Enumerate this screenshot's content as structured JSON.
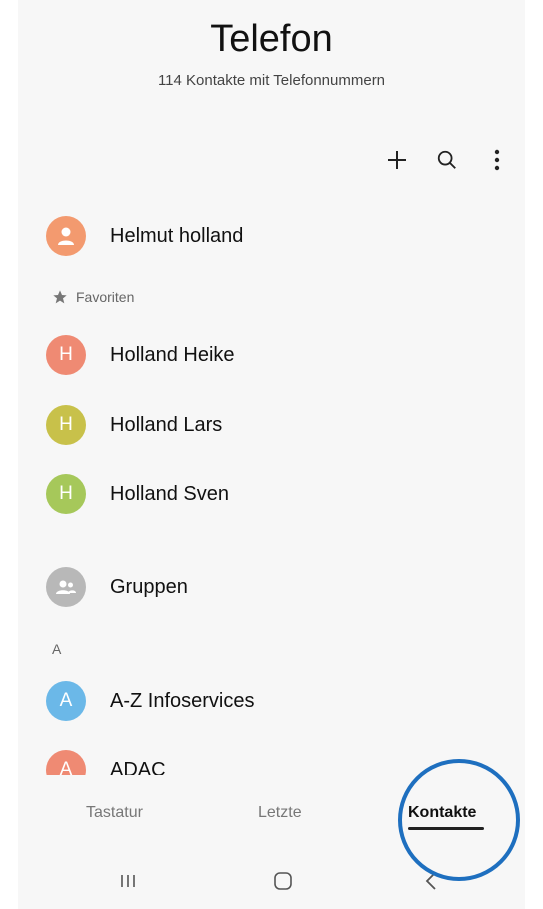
{
  "header": {
    "title": "Telefon",
    "subtitle": "114 Kontakte mit Telefonnummern"
  },
  "toolbar": {
    "add_icon": "plus-icon",
    "search_icon": "search-icon",
    "more_icon": "more-vertical-icon"
  },
  "profile": {
    "name": "Helmut holland",
    "avatar_color": "#f39a6f"
  },
  "favorites": {
    "label": "Favoriten",
    "items": [
      {
        "initial": "H",
        "name": "Holland Heike",
        "color": "#ef8a73"
      },
      {
        "initial": "H",
        "name": "Holland Lars",
        "color": "#c8c14a"
      },
      {
        "initial": "H",
        "name": "Holland Sven",
        "color": "#a6c85a"
      }
    ]
  },
  "groups": {
    "label": "Gruppen",
    "color": "#b8b8b8"
  },
  "index_section": {
    "letter": "A"
  },
  "contacts": [
    {
      "initial": "A",
      "name": "A-Z Infoservices",
      "color": "#6bb8e8"
    },
    {
      "initial": "A",
      "name": "ADAC",
      "color": "#ef8a73"
    }
  ],
  "tabs": [
    {
      "label": "Tastatur",
      "active": false
    },
    {
      "label": "Letzte",
      "active": false
    },
    {
      "label": "Kontakte",
      "active": true
    }
  ],
  "navigation": {
    "recents_icon": "recent-apps-icon",
    "home_icon": "home-icon",
    "back_icon": "back-icon"
  },
  "highlight_color": "#1e6fbf"
}
